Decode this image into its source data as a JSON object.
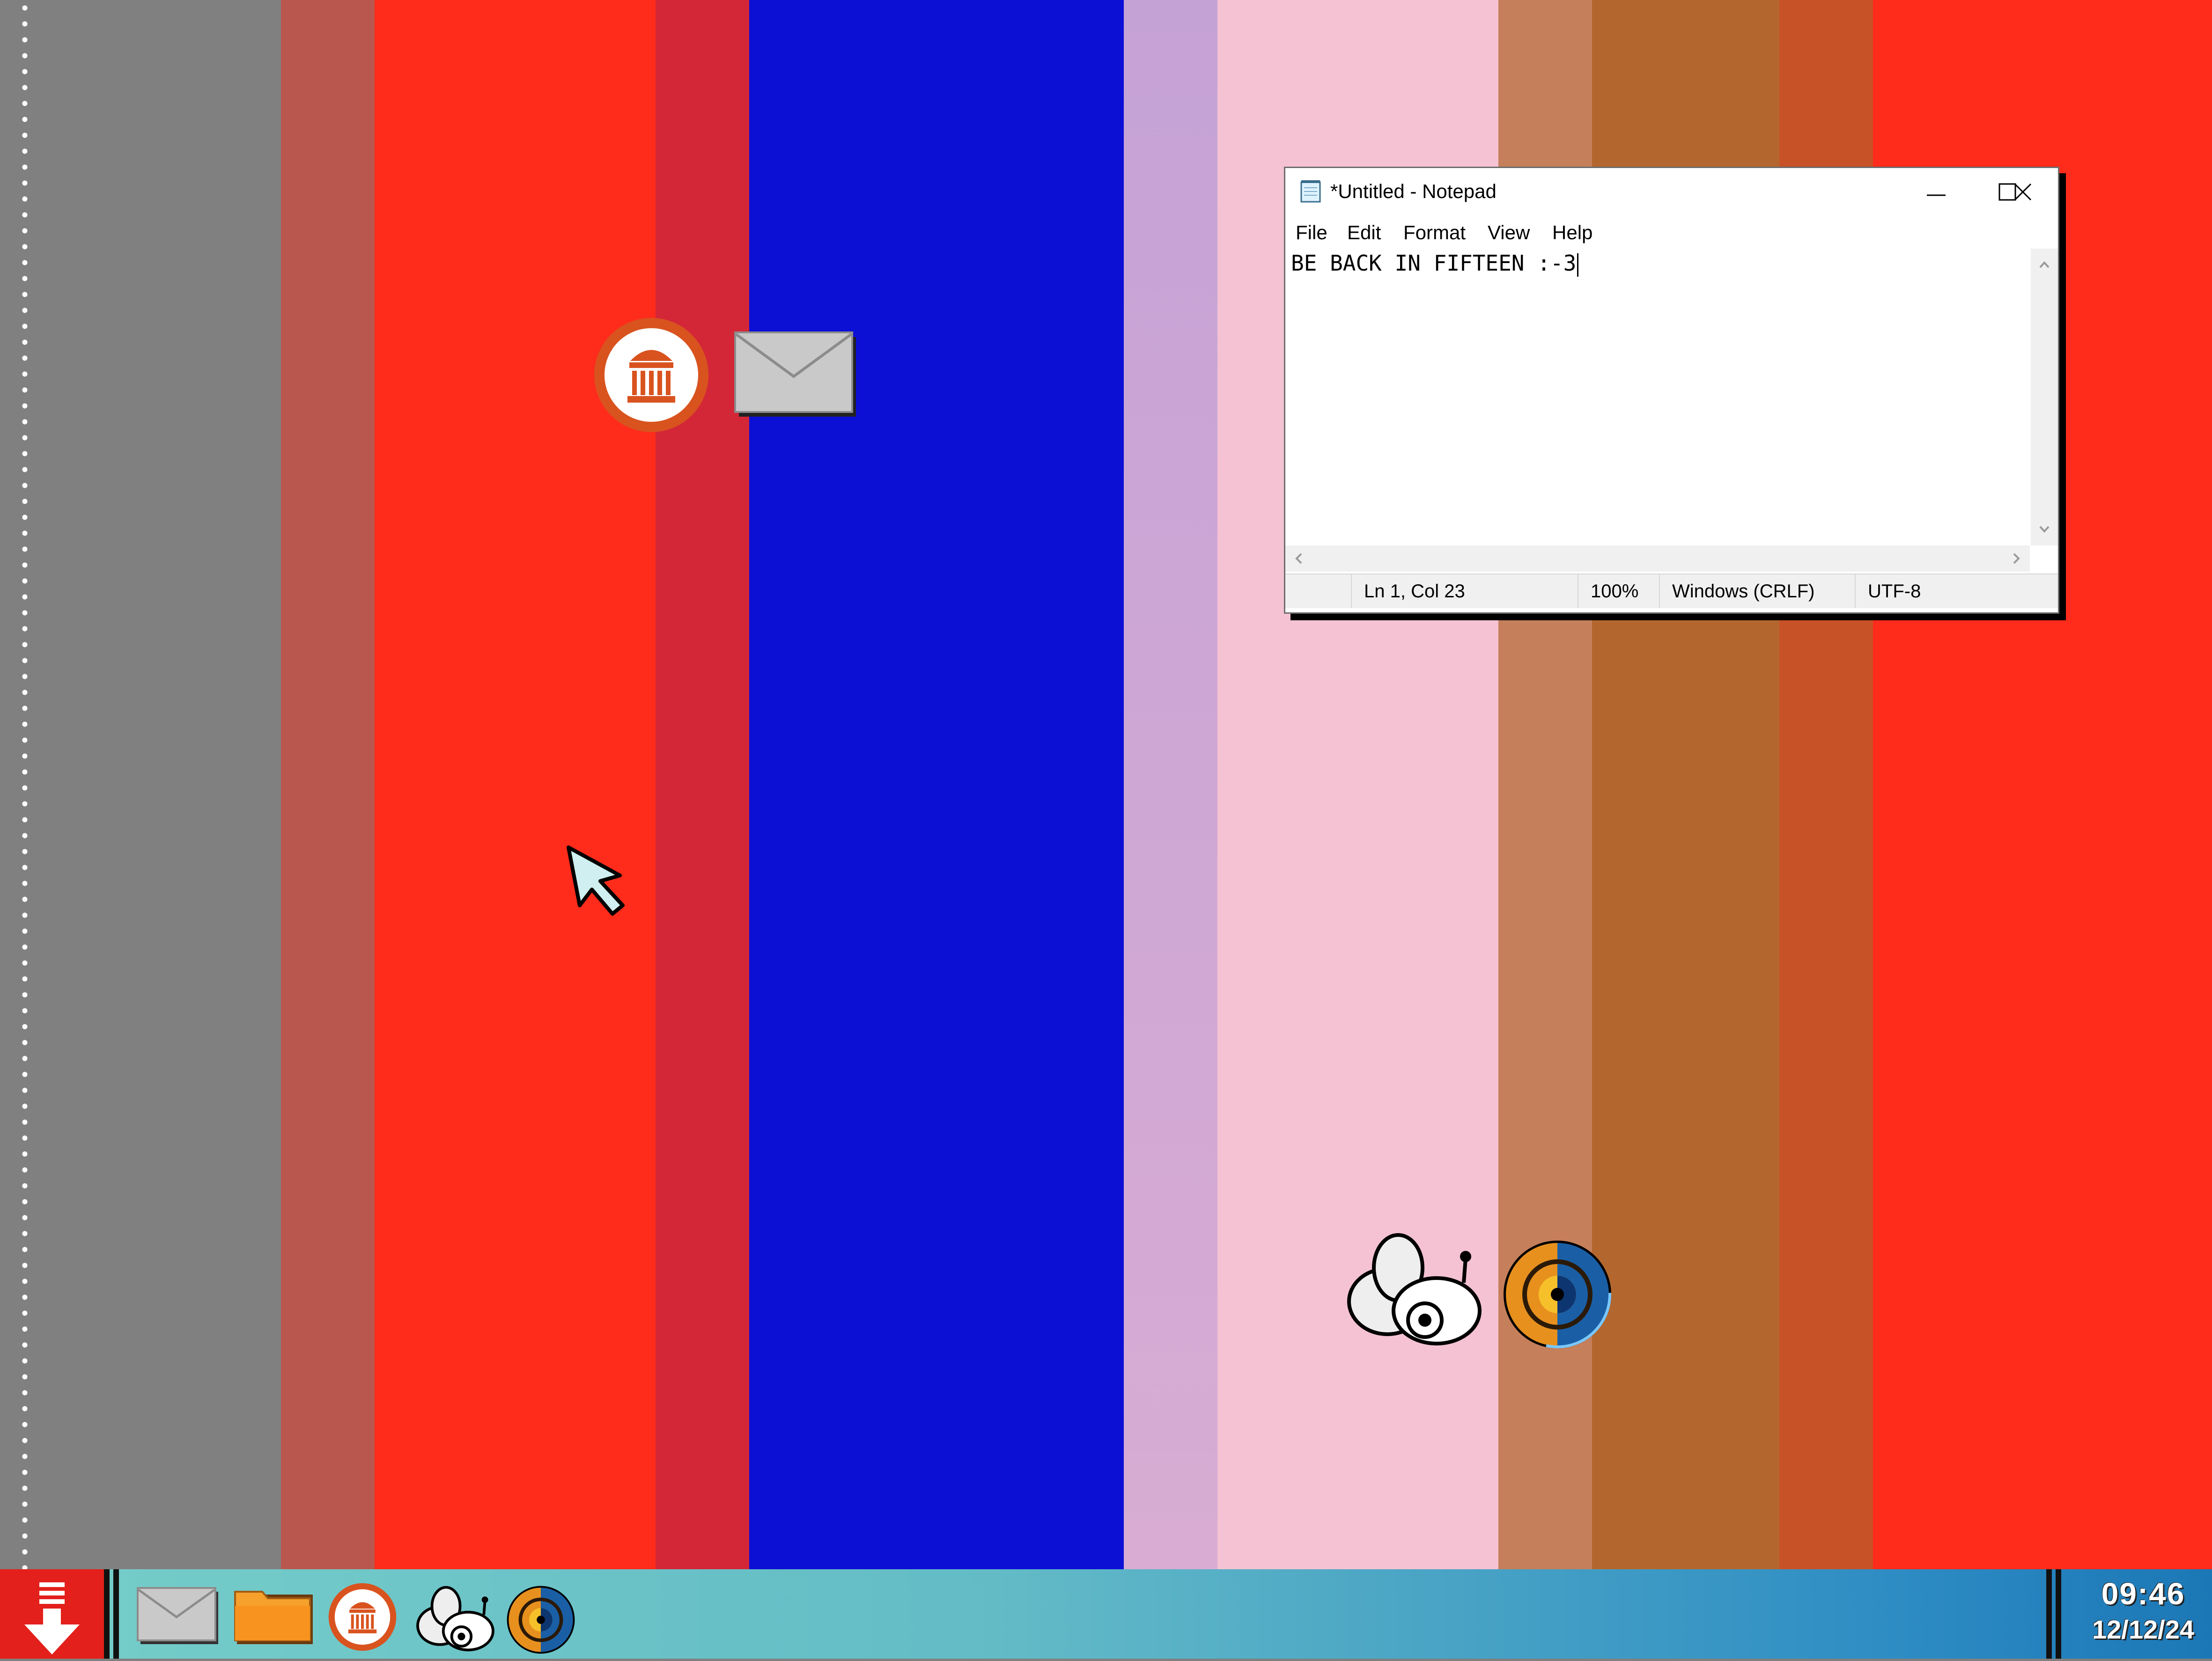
{
  "desktop": {
    "stripe_colors": [
      "#808080",
      "#b9574e",
      "#ff2b1b",
      "#d32737",
      "#0c10d5",
      "#c5a2d6",
      "#f4c2d3",
      "#c57f5a",
      "#b3672e",
      "#c85227",
      "#ff2b1b"
    ],
    "icons": [
      "library-icon",
      "mail-icon",
      "bee-icon",
      "radar-disc-icon"
    ]
  },
  "notepad": {
    "title": "*Untitled - Notepad",
    "menu": [
      "File",
      "Edit",
      "Format",
      "View",
      "Help"
    ],
    "text": "BE BACK IN FIFTEEN :-3",
    "status": {
      "position": "Ln 1, Col 23",
      "zoom": "100%",
      "line_ending": "Windows (CRLF)",
      "encoding": "UTF-8"
    }
  },
  "taskbar": {
    "start_icon": "download-arrow-icon",
    "pinned": [
      "mail-icon",
      "folder-icon",
      "library-icon",
      "bee-icon",
      "radar-disc-icon"
    ],
    "clock": {
      "time": "09:46",
      "date": "12/12/24"
    },
    "accent": "#e3201b"
  }
}
